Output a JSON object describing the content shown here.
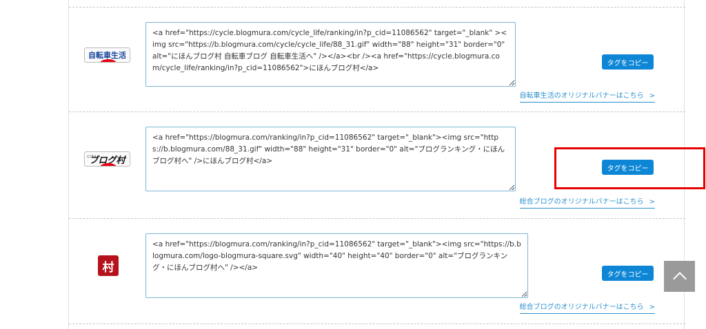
{
  "rows": [
    {
      "banner_label": "自転車生活",
      "banner_icon": "cycle-life-banner",
      "code": "<a href=\"https://cycle.blogmura.com/cycle_life/ranking/in?p_cid=11086562\" target=\"_blank\" ><img src=\"https://b.blogmura.com/cycle/cycle_life/88_31.gif\" width=\"88\" height=\"31\" border=\"0\" alt=\"にほんブログ村 自転車ブログ 自転車生活へ\" /></a><br /><a href=\"https://cycle.blogmura.com/cycle_life/ranking/in?p_cid=11086562\">にほんブログ村</a>",
      "copy_label": "タグをコピー",
      "link_label": "自転車生活のオリジナルバナーはこちら",
      "link_arrow": ">"
    },
    {
      "banner_label": "ブログ村",
      "banner_small": "にほん",
      "banner_icon": "blogmura-banner",
      "code": "<a href=\"https://blogmura.com/ranking/in?p_cid=11086562\" target=\"_blank\"><img src=\"https://b.blogmura.com/88_31.gif\" width=\"88\" height=\"31\" border=\"0\" alt=\"ブログランキング・にほんブログ村へ\" />にほんブログ村</a>",
      "copy_label": "タグをコピー",
      "link_label": "総合ブログのオリジナルバナーはこちら",
      "link_arrow": ">"
    },
    {
      "banner_label": "村",
      "banner_icon": "blogmura-square-logo",
      "code": "<a href=\"https://blogmura.com/ranking/in?p_cid=11086562\" target=\"_blank\"><img src=\"https://b.blogmura.com/logo-blogmura-square.svg\" width=\"40\" height=\"40\" border=\"0\" alt=\"ブログランキング・にほんブログ村へ\" /></a>",
      "copy_label": "タグをコピー",
      "link_label": "総合ブログのオリジナルバナーはこちら",
      "link_arrow": ">"
    }
  ],
  "highlight_color": "#e60000",
  "button_color": "#0d86d6",
  "scroll_top_icon": "chevron-up-icon"
}
